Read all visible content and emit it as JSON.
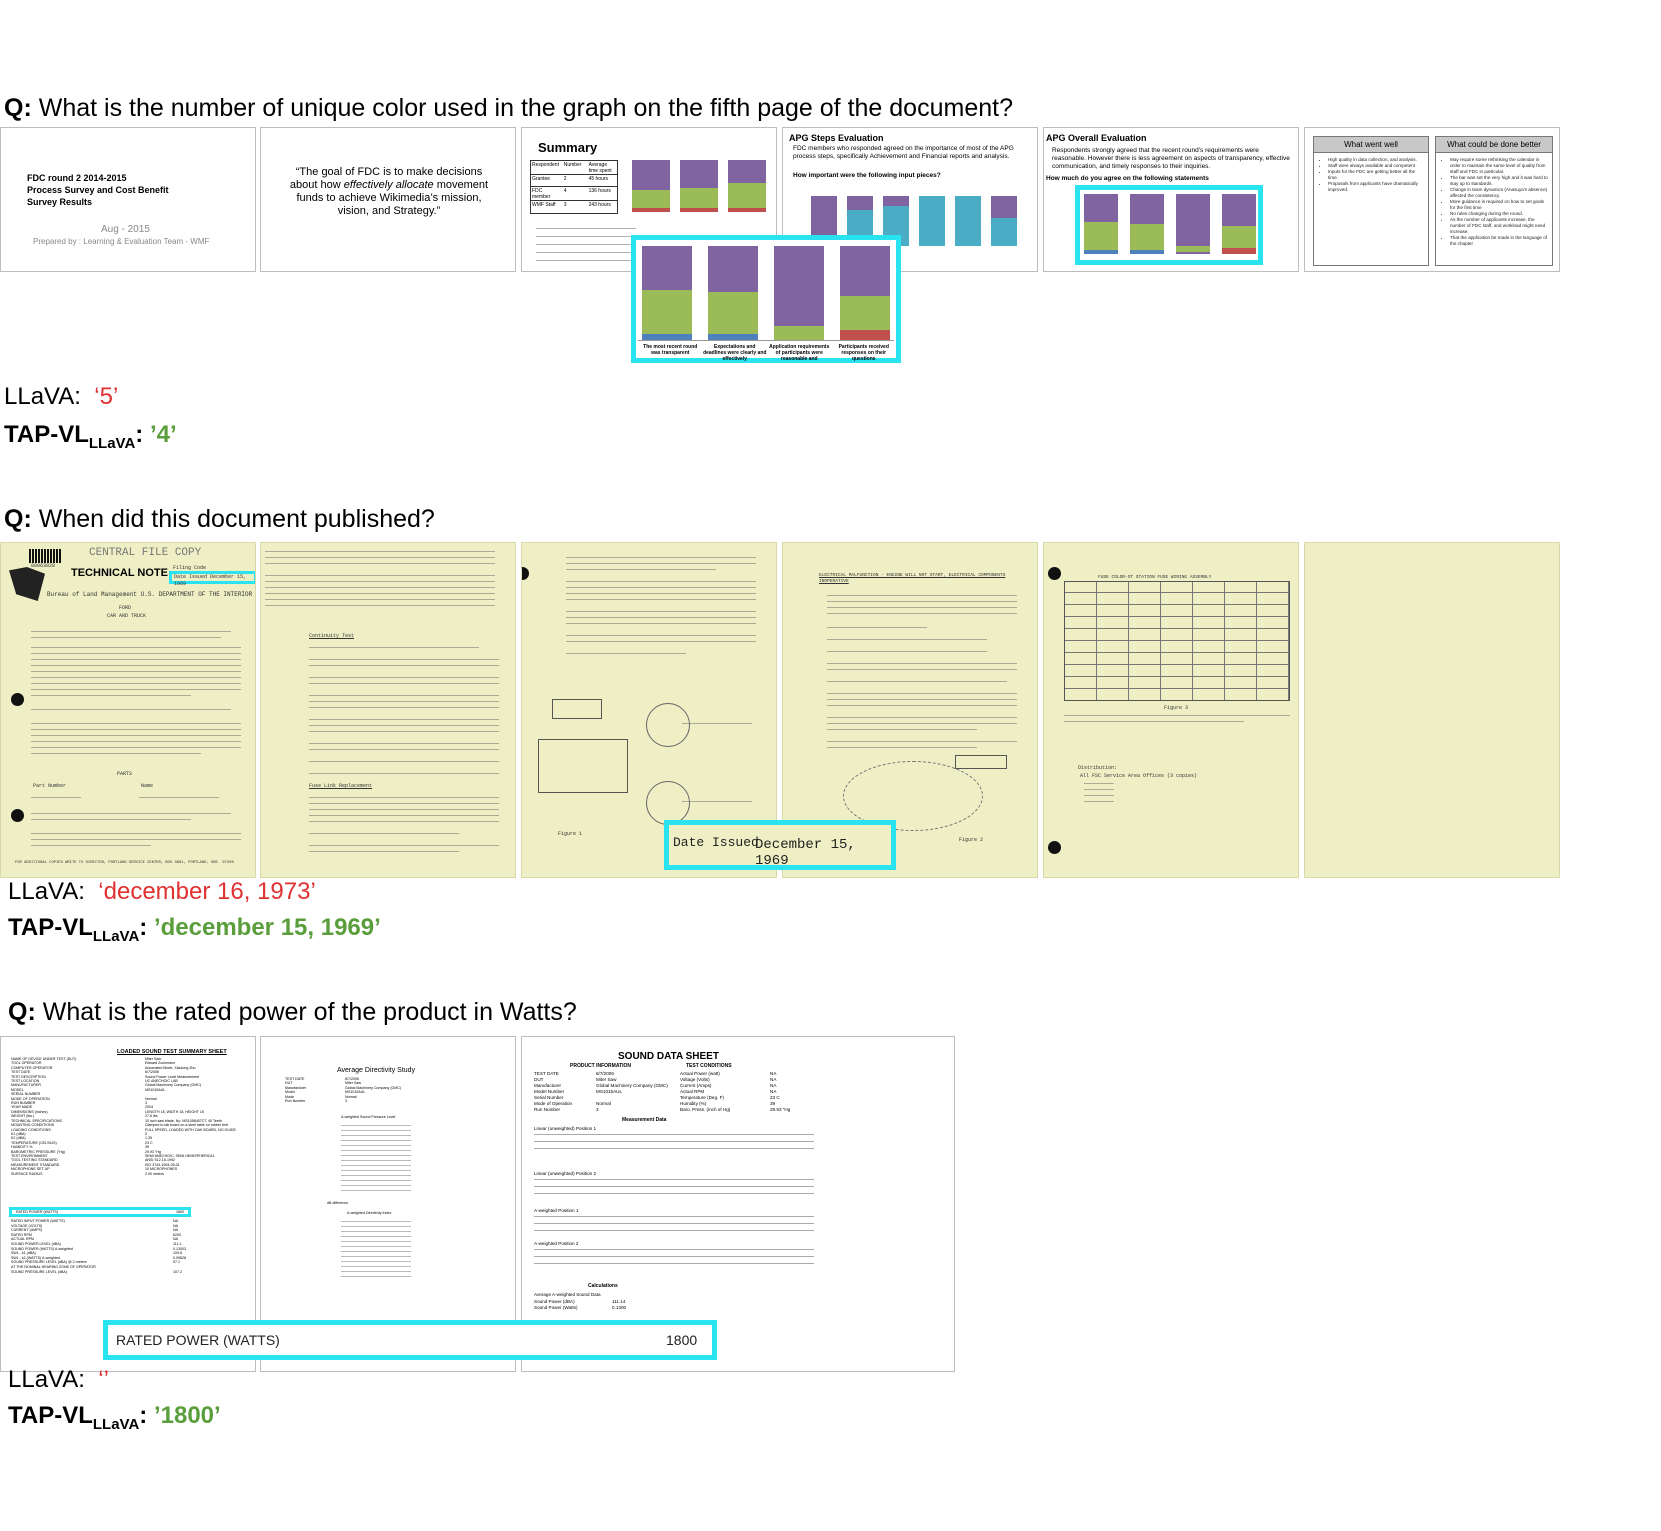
{
  "q1": {
    "prefix": "Q:",
    "question": " What is the number of unique color used in the graph on the fifth page of the document?",
    "page1": {
      "title1": "FDC round 2 2014-2015",
      "title2": "Process Survey and Cost Benefit",
      "title3": "Survey Results",
      "date": "Aug - 2015",
      "prepared": "Prepared by : Learning & Evaluation Team - WMF"
    },
    "page2": {
      "quote_a": "“The goal of FDC is to make decisions about how ",
      "quote_em": "effectively allocate",
      "quote_b": " movement funds to achieve Wikimedia’s mission, vision, and Strategy.”"
    },
    "page3": {
      "title": "Summary",
      "table_headers": [
        "Respondent",
        "Number",
        "Average time spent"
      ],
      "table_rows": [
        [
          "Grantee",
          "2",
          "45 hours"
        ],
        [
          "FDC member",
          "4",
          "136 hours"
        ],
        [
          "WMF Staff",
          "3",
          "243 hours"
        ]
      ]
    },
    "page4": {
      "title": "APG Steps Evaluation",
      "text": "FDC members who responded agreed on the importance of most of the APG process steps, specifically Achievement and Financial reports and analysis.",
      "subtitle": "How important were the following input pieces?"
    },
    "page5": {
      "title": "APG Overall Evaluation",
      "text": "Respondents strongly agreed that the recent round’s requirements were reasonable. However there is less agreement on aspects of transparency, effective communication, and timely responses to their inquiries.",
      "subtitle": "How much do you agree on the following statements"
    },
    "page6": {
      "col1": "What went well",
      "col2": "What could be done better",
      "items1": [
        "High quality in data collection, and analysis.",
        "Staff were always available and competent",
        "Inputs for the FDC are getting better all the time.",
        "Proposals from applicants have dramatically improved."
      ],
      "items2": [
        "May require some rethinking the calendar in order to maintain the same level of quality from staff and FDC in particular.",
        "The bar was set the very high and it was hard to stay up to standards.",
        "Change in team dynamics (Anasuya’s absence) affected the consistency.",
        "More guidance is required on how to set goals for the first time",
        "No rules changing during the round.",
        "As the number of applicants increase, the number of FDC staff, and workload might need increase.",
        "That the application be made in the language of the chapter"
      ]
    },
    "zoom_labels": [
      "The most recent round was transparent",
      "Expectations and deadlines were clearly and effectively",
      "Application requirements of participants were reasonable and",
      "Participants received responses on their questions"
    ],
    "llava_label": "LLaVA:",
    "llava_answer": "‘5’",
    "tap_label": "TAP-VL",
    "tap_sub": "LLaVA",
    "tap_colon": ":",
    "tap_answer": " ’4’"
  },
  "q2": {
    "prefix": "Q:",
    "question": " When did this document published?",
    "page1": {
      "barcode_num": "88063828",
      "header": "CENTRAL FILE COPY",
      "technical_note": "TECHNICAL NOTE",
      "filing_code": "Filing Code",
      "date_issued_small": "Date Issued December 15, 1969",
      "bureau": "Bureau of Land Management   U.S. DEPARTMENT OF THE INTERIOR",
      "ford": "FORD",
      "car_truck": "CAR AND TRUCK",
      "parts": "PARTS",
      "part_number": "Part Number",
      "name": "Name",
      "footer": "FOR ADDITIONAL COPIES WRITE TO DIRECTOR, PORTLAND SERVICE CENTER, BOX 3861, PORTLAND, ORE. 97208"
    },
    "page2": {
      "continuity_test": "Continuity Test",
      "fuse_link_replacement": "Fuse Link Replacement"
    },
    "page3": {
      "figure": "Figure 1"
    },
    "page4": {
      "header": "ELECTRICAL MALFUNCTION - ENGINE WILL NOT START, ELECTRICAL COMPONENTS INOPERATIVE",
      "figure": "Figure 2"
    },
    "page5": {
      "table_title": "FUSE COLOR-ST STATION FUSE WIRING ASSEMBLY",
      "figure": "Figure 3",
      "distribution": "Distribution:",
      "dist_line": "All FSC Service Area Offices (3 copies)"
    },
    "zoom_label": "Date Issued",
    "zoom_value": "December 15, 1969",
    "llava_label": "LLaVA:",
    "llava_answer": "‘december 16, 1973’",
    "tap_label": "TAP-VL",
    "tap_sub": "LLaVA",
    "tap_colon": ":",
    "tap_answer": " ’december 15, 1969’"
  },
  "q3": {
    "prefix": "Q:",
    "question": " What is the rated power of the product in Watts?",
    "page1": {
      "title": "LOADED SOUND TEST  SUMMARY SHEET",
      "rows": [
        [
          "NAME OF DEVICE UNDER TEST (DUT)",
          "Miter Saw"
        ],
        [
          "TOOL OPERATOR",
          "Edward Zochmann"
        ],
        [
          "COMPUTER OPERATOR",
          "Automated Mode, Xiaolong Zhu"
        ],
        [
          "TEST DATE",
          "6/7/2006"
        ],
        [
          "TEST DESCRIPTION",
          "Sound Power Level Measurement"
        ],
        [
          "TEST LOCATION",
          "UC ANECHOIC LAB"
        ],
        [
          "MANUFACTURER",
          "Global Machinery Company (GMC)"
        ],
        [
          "MODEL",
          "MS1015AUL"
        ],
        [
          "SERIAL NUMBER",
          ""
        ],
        [
          "MODE OF OPERATION",
          "Normal"
        ],
        [
          "RUN NUMBER",
          "3"
        ],
        [
          "YEAR MADE",
          "2004"
        ],
        [
          "DIMENSIONS (inches)",
          "LENGTH 18, WIDTH 18, HEIGHT 15"
        ],
        [
          "WEIGHT (lbs.)",
          "27.6 lbs"
        ],
        [
          "TECHNICAL SPECIFICATIONS",
          "10 inch saw blade, No. MS1058407CT, 40 Teeth"
        ],
        [
          "MOUNTING CONDITIONS",
          "Clamped to lab board on a steel table on rubber feet"
        ],
        [
          "LOADING CONDITIONS",
          "FULL SPEED, LOADED WITH OAK BOARD, NO GUIDE"
        ],
        [
          "K1 (dBA)",
          "0"
        ],
        [
          "K2 (dBA)",
          "1.35"
        ],
        [
          "TEMPERATURE (CELSIUS)",
          "23 C"
        ],
        [
          "HUMIDITY %",
          "39"
        ],
        [
          "BAROMETRIC PRESSURE (\"Hg)",
          "29.93 \"Hg"
        ],
        [
          "TEST ENVIRONMENT",
          "SEMI ANECHOIC, SEMI HEMISPHERICAL"
        ],
        [
          "TOOL TESTING STANDARD",
          "ANSI S12.15-1992"
        ],
        [
          "MEASUREMENT STANDARD",
          "ISO 3744-1994-05-01"
        ],
        [
          "MICROPHONE SET UP",
          "10 MICROPHONES"
        ],
        [
          "SURFACE RADIUS",
          "2.00 meters"
        ]
      ],
      "rated_row": [
        "RATED POWER (WATTS)",
        "1800"
      ],
      "rows2": [
        [
          "RATED INPUT POWER (WATTS)",
          "NA"
        ],
        [
          "VOLTAGE (VOLTS)",
          "NA"
        ],
        [
          "CURRENT (AMPS)",
          "NA"
        ],
        [
          "RATED RPM",
          "6200"
        ],
        [
          "ACTUAL RPM",
          "NA"
        ],
        [
          "SOUND POWER LEVEL (dBA)",
          "111.1"
        ],
        [
          "SOUND POWER (WATTS) A-weighted",
          "0.13003"
        ],
        [
          "SWL - k1 (dBA)",
          "109.8"
        ],
        [
          "SWL - k2 (WATTS) A-weighted",
          "0.09828"
        ],
        [
          "SOUND PRESSURE LEVEL (dBA) @ 2 meters",
          "97.1"
        ],
        [
          "AT THE NOMINAL HEARING ZONE OF OPERATOR",
          ""
        ],
        [
          "SOUND PRESSURE LEVEL (dBA)",
          "107.2"
        ]
      ]
    },
    "page2": {
      "title": "Average Directivity Study",
      "meta": [
        [
          "TEST DATE",
          "6/7/2006"
        ],
        [
          "DUT",
          "Miter Saw"
        ],
        [
          "Manufacturer",
          "Global Machinery Company (GMC)"
        ],
        [
          "Model",
          "MS1015AUL"
        ],
        [
          "Mode",
          "Normal"
        ],
        [
          "Run Number",
          "3"
        ]
      ],
      "sub1": "A-weighted Sound Pressure Level",
      "sub2": "A-weighted Directivity Index",
      "db_diff": "dB difference"
    },
    "page3": {
      "title": "SOUND DATA SHEET",
      "prod_info": "PRODUCT INFORMATION",
      "test_cond": "TEST CONDITIONS",
      "left": [
        [
          "TEST DATE",
          "6/7/2006"
        ],
        [
          "DUT",
          "Miter Saw"
        ],
        [
          "Manufacturer",
          "Global Machinery Company (GMC)"
        ],
        [
          "Model Number",
          "MS1015AUL"
        ],
        [
          "Serial Number",
          ""
        ],
        [
          "Mode of Operation",
          "Normal"
        ],
        [
          "Run Number",
          "3"
        ]
      ],
      "right": [
        [
          "Actual Power (watt)",
          "NA"
        ],
        [
          "Voltage (Volts)",
          "NA"
        ],
        [
          "Current (Amps)",
          "NA"
        ],
        [
          "Actual RPM",
          "NA"
        ],
        [
          "Temperature (Deg. F)",
          "23 C"
        ],
        [
          "Humidity (%)",
          "39"
        ],
        [
          "Baro. Press. (inch of Hg)",
          "29.93 \"Hg"
        ]
      ],
      "measurement": "Measurement Data",
      "sections": [
        "Linear (unweighted) Position 1",
        "Linear (unweighted) Position 2",
        "A-weighted Position 1",
        "A-weighted Position 2"
      ],
      "calculations": "Calculations",
      "avg": "Average A-weighted Sound Data",
      "avg_rows": [
        [
          "Sound Power (dBA)",
          "111.14"
        ],
        [
          "Sound Power (Watts)",
          "0.1300"
        ]
      ]
    },
    "zoom_label": "RATED POWER (WATTS)",
    "zoom_value": "1800",
    "llava_label": "LLaVA:",
    "llava_answer": "‘’",
    "tap_label": "TAP-VL",
    "tap_sub": "LLaVA",
    "tap_colon": ":",
    "tap_answer": " ’1800’"
  },
  "colors": {
    "highlight": "#29e3f0",
    "wrong": "#e03131",
    "right": "#5a9e3c",
    "purple": "#8064a2",
    "green": "#9bbb59",
    "blue": "#4f81bd",
    "red": "#c0504d"
  }
}
